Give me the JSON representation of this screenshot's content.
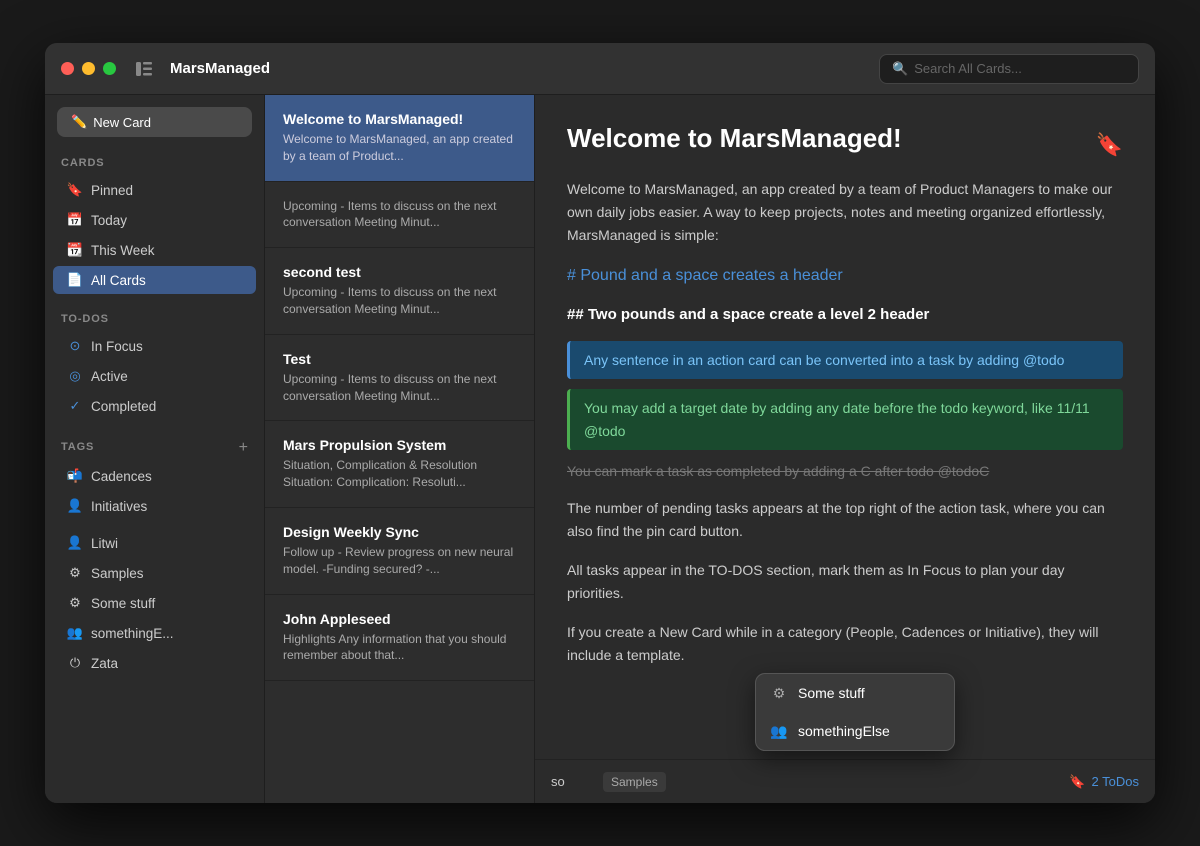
{
  "window": {
    "title": "MarsManaged"
  },
  "search": {
    "placeholder": "Search All Cards..."
  },
  "sidebar": {
    "new_card_label": "New Card",
    "cards_section": "CARDS",
    "cards_items": [
      {
        "id": "pinned",
        "icon": "🔖",
        "label": "Pinned"
      },
      {
        "id": "today",
        "icon": "📅",
        "label": "Today"
      },
      {
        "id": "this-week",
        "icon": "📆",
        "label": "This Week"
      },
      {
        "id": "all-cards",
        "icon": "📄",
        "label": "All Cards",
        "active": true
      }
    ],
    "todos_section": "TO-DOS",
    "todos_items": [
      {
        "id": "in-focus",
        "icon": "🔵",
        "label": "In Focus"
      },
      {
        "id": "active",
        "icon": "🔵",
        "label": "Active"
      },
      {
        "id": "completed",
        "icon": "✅",
        "label": "Completed"
      }
    ],
    "tags_section": "TAGS",
    "tags_items": [
      {
        "id": "cadences",
        "icon": "📬",
        "label": "Cadences"
      },
      {
        "id": "initiatives",
        "icon": "👤",
        "label": "Initiatives"
      }
    ],
    "people_items": [
      {
        "id": "litwi",
        "icon": "👤",
        "label": "Litwi"
      },
      {
        "id": "samples",
        "icon": "⚙",
        "label": "Samples"
      },
      {
        "id": "some-stuff",
        "icon": "⚙",
        "label": "Some stuff"
      },
      {
        "id": "something-else",
        "icon": "👥",
        "label": "somethingE..."
      },
      {
        "id": "zata",
        "icon": "⏻",
        "label": "Zata"
      }
    ]
  },
  "cards_list": {
    "items": [
      {
        "id": "welcome",
        "title": "Welcome to MarsManaged!",
        "preview": "Welcome to MarsManaged, an app created by a team of Product...",
        "selected": true
      },
      {
        "id": "upcoming",
        "title": "",
        "preview": "Upcoming - Items to discuss on the next conversation   Meeting Minut..."
      },
      {
        "id": "second-test",
        "title": "second test",
        "preview": "Upcoming - Items to discuss on the next conversation   Meeting Minut..."
      },
      {
        "id": "test",
        "title": "Test",
        "preview": "Upcoming - Items to discuss on the next conversation   Meeting Minut..."
      },
      {
        "id": "mars-propulsion",
        "title": "Mars Propulsion System",
        "preview": "Situation, Complication & Resolution Situation:  Complication:  Resoluti..."
      },
      {
        "id": "design-weekly",
        "title": "Design Weekly Sync",
        "preview": "Follow up - Review progress on new neural model.  -Funding secured? -..."
      },
      {
        "id": "john-appleseed",
        "title": "John Appleseed",
        "preview": "Highlights Any information that you should remember about that..."
      }
    ]
  },
  "detail": {
    "title": "Welcome to MarsManaged!",
    "pinned": true,
    "paragraph1": "Welcome to MarsManaged, an app created by a team of Product Managers to make our own daily jobs easier. A way to keep projects, notes and meeting organized effortlessly, MarsManaged is simple:",
    "header1": "# Pound and a space creates a header",
    "header2": "## Two pounds and a space create a level 2 header",
    "highlight_blue": "Any sentence in an action card can be converted into a task by adding @todo",
    "highlight_green": "You may add a target date by adding any date before the todo keyword, like 11/11 @todo",
    "strikethrough": "You can mark a task as completed by adding a C after todo @todoC",
    "paragraph2": "The number of pending tasks appears at the top right of the action task, where you can also find the pin card button.",
    "paragraph3": "All tasks appear in the TO-DOS section, mark them as In Focus to plan your day priorities.",
    "paragraph4": "If you create a New Card while in a category (People, Cadences or Initiative), they will include a template."
  },
  "footer": {
    "input_value": "so",
    "tag_label": "Samples",
    "todos_icon": "🔖",
    "todos_label": "2 ToDos"
  },
  "autocomplete": {
    "items": [
      {
        "id": "some-stuff",
        "icon": "⚙",
        "label": "Some stuff"
      },
      {
        "id": "something-else",
        "icon": "👥",
        "label": "somethingElse"
      }
    ]
  }
}
